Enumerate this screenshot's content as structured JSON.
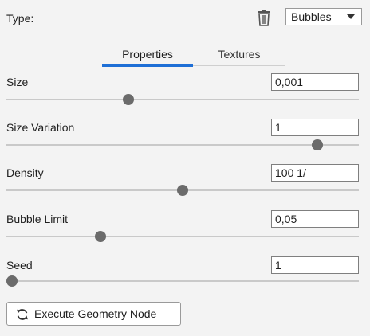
{
  "header": {
    "type_label": "Type:",
    "type_value": "Bubbles"
  },
  "tabs": [
    {
      "label": "Properties",
      "active": true
    },
    {
      "label": "Textures",
      "active": false
    }
  ],
  "params": [
    {
      "label": "Size",
      "value": "0,001",
      "slider_fraction": 0.34
    },
    {
      "label": "Size Variation",
      "value": "1",
      "slider_fraction": 0.895
    },
    {
      "label": "Density",
      "value": "100 1/",
      "slider_fraction": 0.5
    },
    {
      "label": "Bubble Limit",
      "value": "0,05",
      "slider_fraction": 0.26
    },
    {
      "label": "Seed",
      "value": "1",
      "slider_fraction": 0.0
    }
  ],
  "actions": {
    "execute_label": "Execute Geometry Node"
  },
  "colors": {
    "accent": "#1e6fd6",
    "thumb": "#6b6b6b"
  },
  "icons": {
    "trash": "trash-icon",
    "dropdown": "chevron-down-icon",
    "refresh": "refresh-icon"
  }
}
